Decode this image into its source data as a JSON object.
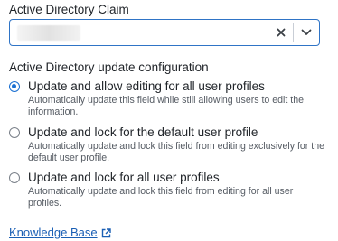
{
  "claim": {
    "label": "Active Directory Claim",
    "selected_value": ""
  },
  "config": {
    "title": "Active Directory update configuration",
    "options": [
      {
        "title": "Update and allow editing for all user profiles",
        "description": "Automatically update this field while still allowing users to edit the information.",
        "checked": true
      },
      {
        "title": "Update and lock for the default user profile",
        "description": "Automatically update and lock this field from editing exclusively for the default user profile.",
        "checked": false
      },
      {
        "title": "Update and lock for all user profiles",
        "description": "Automatically update and lock this field from editing for all user profiles.",
        "checked": false
      }
    ]
  },
  "link": {
    "label": "Knowledge Base",
    "icon": "external-link-icon"
  },
  "icons": {
    "clear": "close-icon",
    "dropdown": "chevron-down-icon"
  },
  "colors": {
    "accent": "#1a6fd1",
    "focus_border": "#2f74c6",
    "link": "#1a5fb4"
  }
}
